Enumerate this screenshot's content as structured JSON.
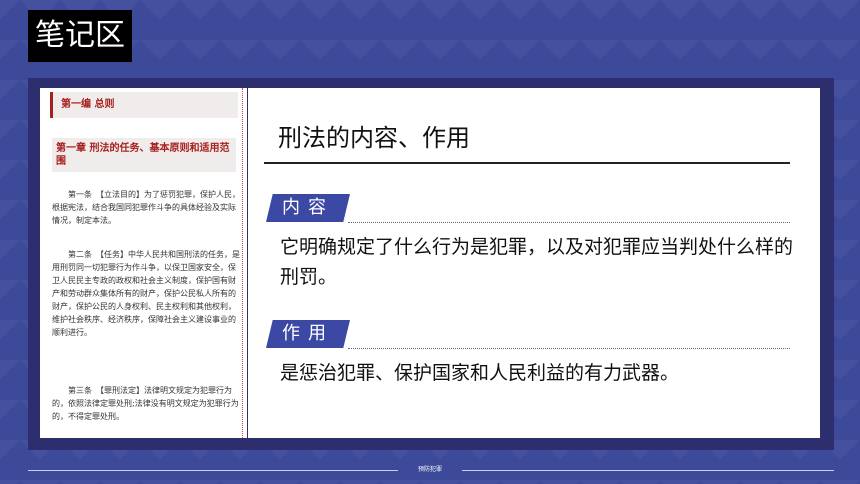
{
  "badge": "笔记区",
  "law": {
    "part": "第一编 总则",
    "chapter": "第一章 刑法的任务、基本原则和适用范围",
    "articles": [
      "第一条　【立法目的】为了惩罚犯罪，保护人民，根据宪法，结合我国同犯罪作斗争的具体经验及实际情况，制定本法。",
      "第二条　【任务】中华人民共和国刑法的任务，是用刑罚同一切犯罪行为作斗争，以保卫国家安全，保卫人民民主专政的政权和社会主义制度，保护国有财产和劳动群众集体所有的财产，保护公民私人所有的财产，保护公民的人身权利、民主权利和其他权利，维护社会秩序、经济秩序，保障社会主义建设事业的顺利进行。",
      "第三条　【罪刑法定】法律明文规定为犯罪行为的，依照法律定罪处刑;法律没有明文规定为犯罪行为的，不得定罪处刑。"
    ]
  },
  "main": {
    "title": "刑法的内容、作用",
    "section1_tag": "内容",
    "section1_text": "它明确规定了什么行为是犯罪，以及对犯罪应当判处什么样的刑罚。",
    "section2_tag": "作用",
    "section2_text": "是惩治犯罪、保护国家和人民利益的有力武器。"
  },
  "footer": "预防犯罪",
  "colors": {
    "accent": "#3b48a4",
    "law_red": "#a6201e",
    "background": "#3d4a9a"
  }
}
